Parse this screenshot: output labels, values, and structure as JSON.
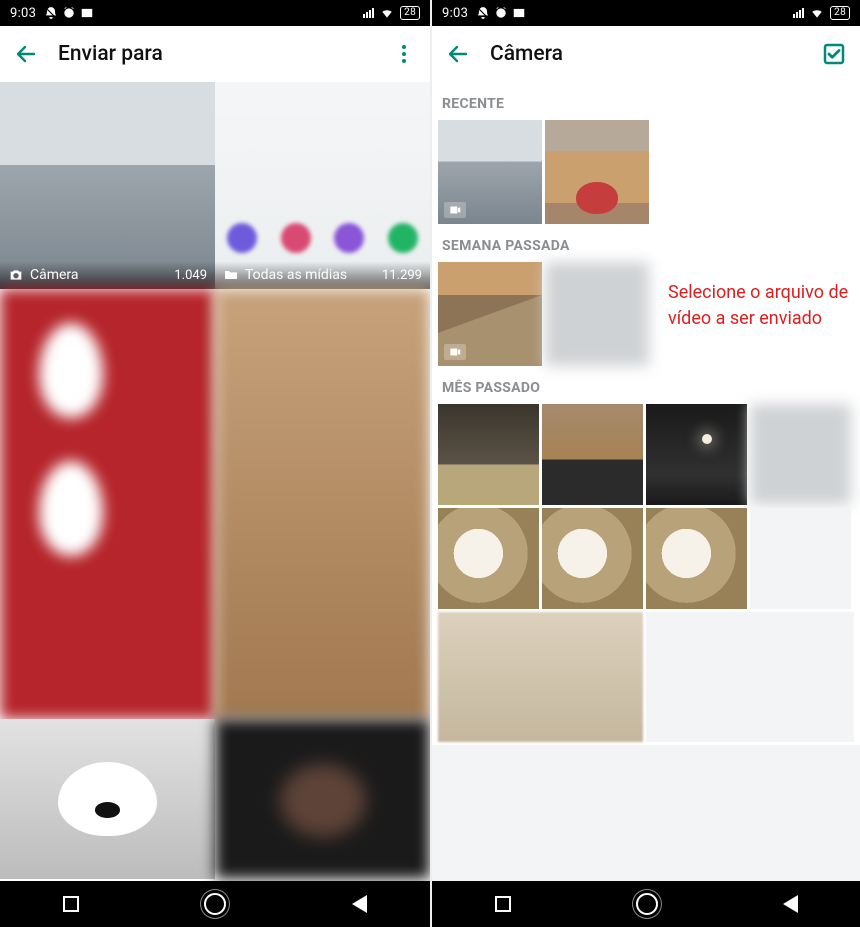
{
  "left": {
    "status": {
      "time": "9:03",
      "battery": "28"
    },
    "app_bar": {
      "title": "Enviar para"
    },
    "albums": [
      {
        "name": "Câmera",
        "count": "1.049"
      },
      {
        "name": "Todas as mídias",
        "count": "11.299"
      }
    ]
  },
  "right": {
    "status": {
      "time": "9:03",
      "battery": "28"
    },
    "app_bar": {
      "title": "Câmera"
    },
    "sections": {
      "recent": "RECENTE",
      "last_week": "SEMANA PASSADA",
      "last_month": "MÊS PASSADO"
    },
    "annotation": "Selecione o arquivo de vídeo a ser enviado"
  }
}
